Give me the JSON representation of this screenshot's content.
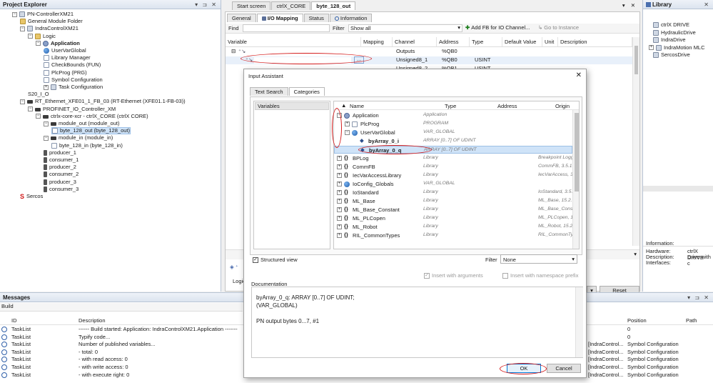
{
  "project_explorer": {
    "title": "Project Explorer",
    "controls": "▾ ⊐ ✕",
    "tree": [
      {
        "label": "PN-ControllerXM21",
        "icon": "root-icon",
        "expander": "−"
      },
      {
        "label": "General Module Folder",
        "icon": "folder-icon"
      },
      {
        "label": "IndraControlXM21",
        "icon": "plc-icon",
        "expander": "−"
      },
      {
        "label": "Logic",
        "icon": "folder-icon",
        "expander": "−"
      },
      {
        "label": "Application",
        "icon": "application-icon",
        "expander": "−",
        "bold": true
      },
      {
        "label": "UserVarGlobal",
        "icon": "globe-icon"
      },
      {
        "label": "Library Manager",
        "icon": "library-icon"
      },
      {
        "label": "CheckBounds (FUN)",
        "icon": "doc-icon"
      },
      {
        "label": "PlcProg (PRG)",
        "icon": "doc-icon"
      },
      {
        "label": "Symbol Configuration",
        "icon": "symbol-icon"
      },
      {
        "label": "Task Configuration",
        "icon": "task-icon",
        "expander": "+"
      },
      {
        "label": "S20_I_O",
        "icon": "none"
      },
      {
        "label": "RT_Ethernet_XFE01_1_FB_03 (RT-Ethernet (XFE01.1-FB-03))",
        "icon": "ethernet-icon",
        "expander": "−"
      },
      {
        "label": "PROFINET_IO_Controller_XM",
        "icon": "profinet-icon",
        "expander": "−"
      },
      {
        "label": "ctrlx-core-xcr - ctrlX_CORE (ctrlX CORE)",
        "icon": "device-icon",
        "expander": "−"
      },
      {
        "label": "module_out (module_out)",
        "icon": "module-icon",
        "expander": "−"
      },
      {
        "label": "byte_128_out (byte_128_out)",
        "icon": "byte-icon",
        "selected": true
      },
      {
        "label": "module_in (module_in)",
        "icon": "module-icon",
        "expander": "−"
      },
      {
        "label": "byte_128_in (byte_128_in)",
        "icon": "byte-icon"
      },
      {
        "label": "producer_1",
        "icon": "plug-icon"
      },
      {
        "label": "consumer_1",
        "icon": "plug-icon"
      },
      {
        "label": "producer_2",
        "icon": "plug-icon"
      },
      {
        "label": "consumer_2",
        "icon": "plug-icon"
      },
      {
        "label": "producer_3",
        "icon": "plug-icon"
      },
      {
        "label": "consumer_3",
        "icon": "plug-icon"
      },
      {
        "label": "Sercos",
        "icon": "sercos-icon"
      }
    ]
  },
  "editor": {
    "doc_tabs": [
      "Start screen",
      "ctrlX_CORE",
      "byte_128_out"
    ],
    "window_controls": "▾ ✕",
    "sub_tabs": [
      "General",
      "I/O Mapping",
      "Status",
      "Information"
    ],
    "find_label": "Find",
    "filter_label": "Filter",
    "filter_value": "Show all",
    "add_fb_label": "Add FB for IO Channel...",
    "goto_label": "Go to Instance",
    "columns": [
      "Variable",
      "Mapping",
      "Channel",
      "Address",
      "Type",
      "Default Value",
      "Unit",
      "Description"
    ],
    "rows": [
      {
        "channel": "Outputs",
        "address": "%QB0",
        "type": ""
      },
      {
        "channel": "Unsigned8_1",
        "address": "%QB0",
        "type": "USINT"
      },
      {
        "channel": "Unsigned8_2",
        "address": "%QB1",
        "type": "USINT"
      }
    ],
    "logic_label": "Logic",
    "reset_label": "Reset"
  },
  "library": {
    "title": "Library",
    "controls": "✕",
    "items": [
      "ctrlX DRIVE",
      "HydraulicDrive",
      "IndraDrive",
      "IndraMotion MLC",
      "SercosDrive"
    ],
    "info_title": "Information:",
    "info_labels": [
      "Hardware:",
      "Description:",
      "Interfaces:"
    ],
    "info_values": [
      "ctrlX DRIVE",
      "Drive with c",
      ""
    ]
  },
  "dialog": {
    "title": "Input Assistant",
    "close": "✕",
    "tabs": [
      "Text Search",
      "Categories"
    ],
    "left_list": [
      "Variables"
    ],
    "columns": [
      "Name",
      "Type",
      "Address",
      "Origin"
    ],
    "items": [
      {
        "name": "Application",
        "type": "Application",
        "address": "",
        "origin": "",
        "expander": "−",
        "icon": "application-icon"
      },
      {
        "name": "PlcProg",
        "type": "PROGRAM",
        "address": "",
        "origin": "",
        "expander": "+",
        "icon": "program-icon"
      },
      {
        "name": "UserVarGlobal",
        "type": "VAR_GLOBAL",
        "address": "",
        "origin": "",
        "expander": "−",
        "icon": "globe-icon"
      },
      {
        "name": "byArray_0_i",
        "type": "ARRAY [0..7] OF UDINT",
        "address": "",
        "origin": "",
        "icon": "variable-icon",
        "bold": true
      },
      {
        "name": "byArray_0_q",
        "type": "ARRAY [0..7] OF UDINT",
        "address": "",
        "origin": "",
        "icon": "variable-icon",
        "bold": true,
        "selected": true
      },
      {
        "name": "BPLog",
        "type": "Library",
        "address": "",
        "origin": "Breakpoint Logg",
        "expander": "+",
        "icon": "braces-icon"
      },
      {
        "name": "CommFB",
        "type": "Library",
        "address": "",
        "origin": "CommFB, 3.5.15",
        "expander": "+",
        "icon": "braces-icon"
      },
      {
        "name": "IecVarAccessLibrary",
        "type": "Library",
        "address": "",
        "origin": "IecVarAccess, 3.",
        "expander": "+",
        "icon": "braces-icon"
      },
      {
        "name": "IoConfig_Globals",
        "type": "VAR_GLOBAL",
        "address": "",
        "origin": "",
        "expander": "+",
        "icon": "globe-icon"
      },
      {
        "name": "IoStandard",
        "type": "Library",
        "address": "",
        "origin": "IoStandard, 3.5.",
        "expander": "+",
        "icon": "braces-icon"
      },
      {
        "name": "ML_Base",
        "type": "Library",
        "address": "",
        "origin": "ML_Base, 15.2.",
        "expander": "+",
        "icon": "braces-icon"
      },
      {
        "name": "ML_Base_Constant",
        "type": "Library",
        "address": "",
        "origin": "ML_Base_Const",
        "expander": "+",
        "icon": "braces-icon"
      },
      {
        "name": "ML_PLCopen",
        "type": "Library",
        "address": "",
        "origin": "ML_PLCopen, 15",
        "expander": "+",
        "icon": "braces-icon"
      },
      {
        "name": "ML_Robot",
        "type": "Library",
        "address": "",
        "origin": "ML_Robot, 15.2.",
        "expander": "+",
        "icon": "braces-icon"
      },
      {
        "name": "RIL_CommonTypes",
        "type": "Library",
        "address": "",
        "origin": "RIL_CommonTyp",
        "expander": "+",
        "icon": "braces-icon"
      }
    ],
    "structured_view_label": "Structured view",
    "filter_label": "Filter",
    "filter_value": "None",
    "insert_args_label": "Insert with arguments",
    "insert_ns_label": "Insert with namespace prefix",
    "documentation_label": "Documentation",
    "doc_lines": [
      "byArray_0_q: ARRAY [0..7] OF UDINT;",
      "(VAR_GLOBAL)",
      "",
      "PN output bytes 0...7, #1"
    ],
    "ok_label": "OK",
    "cancel_label": "Cancel"
  },
  "messages": {
    "title": "Messages",
    "controls": "▾ ⊐ ✕",
    "category": "Build",
    "columns": [
      "ID",
      "Description",
      "Position",
      "Path"
    ],
    "rows": [
      {
        "id": "TaskList",
        "desc": "------ Build started: Application: IndraControlXM21.Application -------",
        "tail": "",
        "pos": "0"
      },
      {
        "id": "TaskList",
        "desc": "Typify code...",
        "tail": "",
        "pos": "0"
      },
      {
        "id": "TaskList",
        "desc": "Number of published variables...",
        "tail": "[IndraControl...",
        "pos": "Symbol Configuration"
      },
      {
        "id": "TaskList",
        "desc": "- total: 0",
        "tail": "[IndraControl...",
        "pos": "Symbol Configuration"
      },
      {
        "id": "TaskList",
        "desc": "- with read access: 0",
        "tail": "[IndraControl...",
        "pos": "Symbol Configuration"
      },
      {
        "id": "TaskList",
        "desc": "- with write access: 0",
        "tail": "[IndraControl...",
        "pos": "Symbol Configuration"
      },
      {
        "id": "TaskList",
        "desc": "- with execute right: 0",
        "tail": "[IndraControl...",
        "pos": "Symbol Configuration"
      }
    ]
  },
  "colors": {
    "annotation": "#d41c1c",
    "selection": "#cfe3f8",
    "panel_header": "#dce4ef"
  }
}
